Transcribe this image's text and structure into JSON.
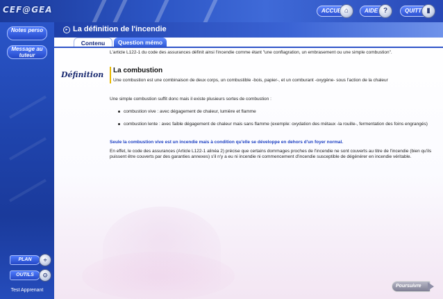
{
  "app": {
    "logo": "CEF@GEA"
  },
  "header": {
    "buttons": [
      {
        "label": "ACCUEIL",
        "icon": "home-icon"
      },
      {
        "label": "AIDE",
        "icon": "help-icon"
      },
      {
        "label": "QUITTER",
        "icon": "exit-icon"
      }
    ]
  },
  "sidebar": {
    "notes_label": "Notes perso",
    "message_label": "Message au tuteur",
    "plan_label": "PLAN",
    "outils_label": "OUTILS",
    "learner": "Test Apprenant"
  },
  "page": {
    "title": "La définition de l'incendie",
    "tabs": [
      "Contenu",
      "Question mémo"
    ],
    "intro": "L'article L122-1 du code des assurances définit ainsi l'incendie comme étant \"une conflagration, un embrasement ou une simple combustion\".",
    "definition_label": "Définition",
    "definition_heading": "La combustion",
    "definition_text": "Une combustion est une combinaison de deux corps, un combustible -bois, papier-, et un comburant -oxygène- sous l'action de la chaleur",
    "combustion_intro": "Une simple combustion suffit donc mais il existe plusieurs sortes de combustion :",
    "bullets": [
      "combustion vive : avec dégagement de chaleur, lumière et flamme",
      "combustion lente : avec faible dégagement de chaleur mais sans flamme (exemple: oxydation des métaux -la rouille-, fermentation des foins engrangés)"
    ],
    "important": "Seule la combustion vive est un incendie mais à condition qu'elle se développe en dehors d'un foyer normal.",
    "conclusion": "En effet, le code des assurances (Article L122-1 alinéa 2) précise que certains dommages proches de l'incendie ne sont couverts au titre de l'incendie (bien qu'ils puissent être couverts par des garanties annexes) s'il n'y a eu ni incendie ni commencement d'incendie susceptible de dégénérer en incendie véritable."
  },
  "footer": {
    "next_label": "Poursuivre"
  }
}
